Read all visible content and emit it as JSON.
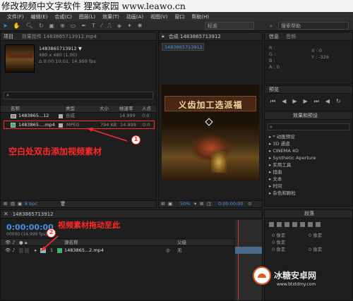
{
  "title_overlay": "修改视频中文字软件 狸窝家园 www.leawo.cn",
  "menu": [
    "文件(F)",
    "编辑(E)",
    "合成(C)",
    "图层(L)",
    "效果(T)",
    "动画(A)",
    "视图(V)",
    "窗口",
    "帮助(H)"
  ],
  "toolbar": {
    "workspace_label": "标准",
    "search_placeholder": "搜索帮助"
  },
  "project_panel": {
    "tab": "项目",
    "tab2": "效果控件 1483865713912.mp4",
    "file_name": "1483865713912 ▼",
    "file_res": "480 x 480 (1.00)",
    "file_dur": "Δ 0:00:10:01, 14.999 fps",
    "columns": [
      "名称",
      "类型",
      "大小",
      "帧速率",
      "入点"
    ],
    "rows": [
      {
        "name": "1483865...12",
        "type": "合成",
        "size": "",
        "fps": "14.999",
        "in": "0:0"
      },
      {
        "name": "1483865....mp4",
        "type": "MPEG",
        "size": "794 KB",
        "fps": "14.999",
        "in": "0:0"
      }
    ],
    "bpc": "8 bpc"
  },
  "composition_panel": {
    "tab": "合成 1483865713912",
    "subtab": "1483865713912",
    "sign_text": "义齿加工选派福",
    "zoom": "50%",
    "timecode": "0:00:00:00"
  },
  "info_panel": {
    "tab1": "信息",
    "tab2": "音频",
    "r": "R :",
    "g": "G :",
    "b": "B :",
    "a": "A : 0",
    "x": "X : 0",
    "y": "Y : -326"
  },
  "preview_panel": {
    "tab": "预览"
  },
  "effects_panel": {
    "tab": "效果和预设",
    "items": [
      "* 动画预设",
      "3D 通道",
      "CINEMA 4D",
      "Synthetic Aperture",
      "实用工具",
      "扭曲",
      "文本",
      "时间",
      "杂色和颗粒"
    ]
  },
  "paragraph_panel": {
    "tab": "段落",
    "values": [
      "0 像素",
      "0 像素",
      "0 像素",
      "0 像素",
      "0 像素"
    ]
  },
  "timeline": {
    "tab": "1483865713912",
    "timecode": "0:00:00:00",
    "fps_line": "00000 (14.999 fps)",
    "col_name": "源名称",
    "col_parent": "父级",
    "layer_num": "1",
    "layer_name": "1483865...2.mp4",
    "parent_value": "无"
  },
  "annotations": {
    "label1": "空白处双击添加视频素材",
    "label2": "视频素材拖动至此",
    "badge1": "1",
    "badge2": "2"
  },
  "watermark": {
    "text": "冰糖安卓网",
    "url": "www.btxtdmy.com"
  }
}
